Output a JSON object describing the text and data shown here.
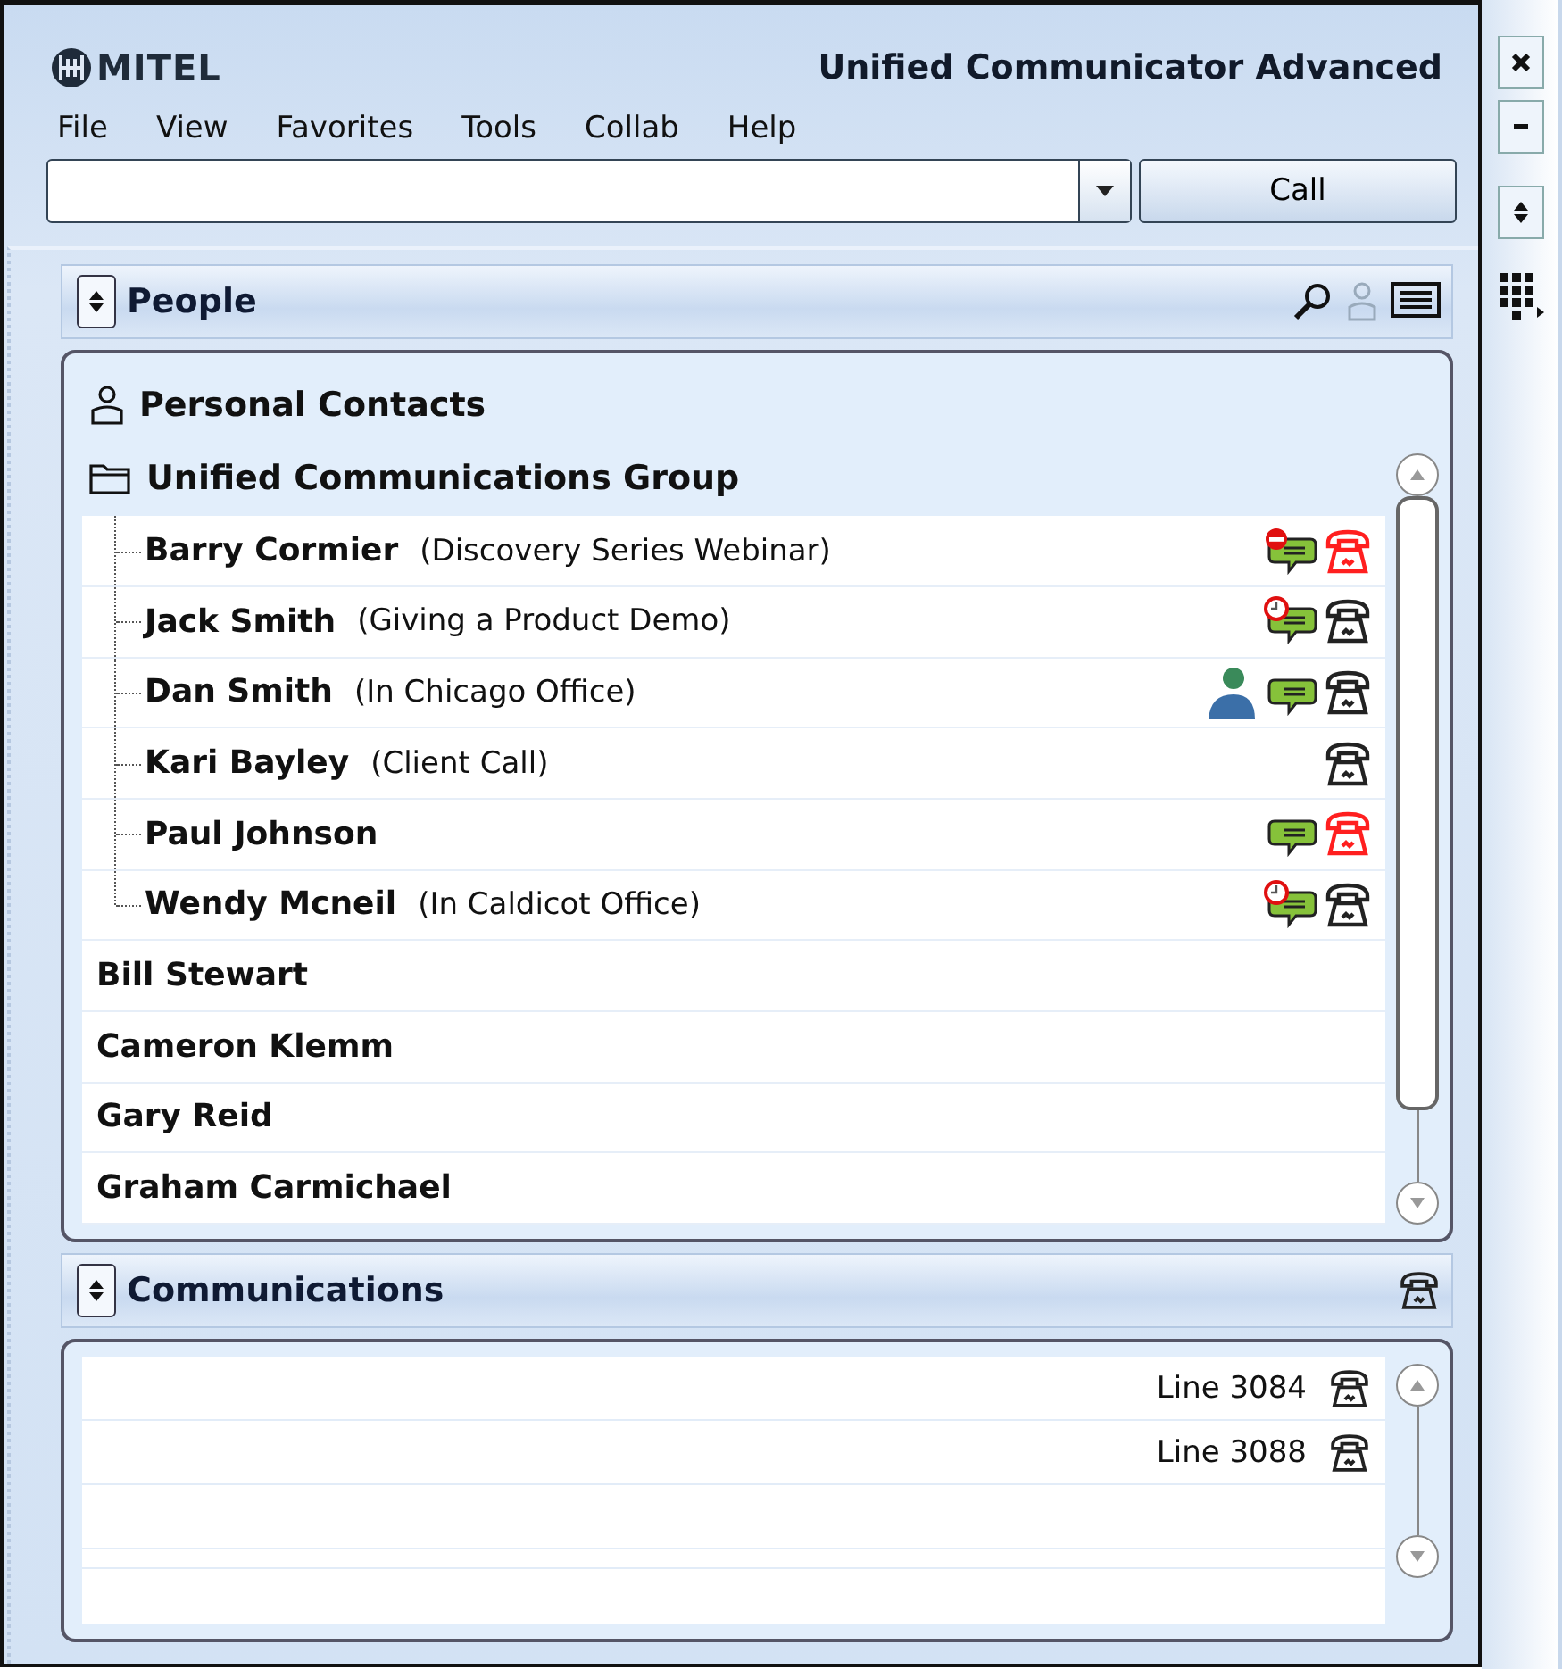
{
  "window": {
    "brand": "MITEL",
    "title": "Unified Communicator Advanced"
  },
  "menu": [
    "File",
    "View",
    "Favorites",
    "Tools",
    "Collab",
    "Help"
  ],
  "dial": {
    "button": "Call"
  },
  "people": {
    "title": "People",
    "personal_contacts": "Personal Contacts",
    "group": {
      "label": "Unified Communications Group",
      "expanded": true,
      "children": [
        {
          "name": "Barry Cormier",
          "status": "(Discovery Series Webinar)",
          "online": false,
          "chat": {
            "kind": "dnd"
          },
          "phone_busy": true
        },
        {
          "name": "Jack Smith",
          "status": "(Giving a Product Demo)",
          "online": false,
          "chat": {
            "kind": "away"
          },
          "phone_busy": false
        },
        {
          "name": "Dan Smith",
          "status": "(In Chicago Office)",
          "online": true,
          "chat": {
            "kind": "available"
          },
          "phone_busy": false
        },
        {
          "name": "Kari Bayley",
          "status": "(Client Call)",
          "online": false,
          "phone_busy": false
        },
        {
          "name": "Paul Johnson",
          "online": false,
          "chat": {
            "kind": "available"
          },
          "phone_busy": true
        },
        {
          "name": "Wendy Mcneil",
          "status": "(In Caldicot Office)",
          "online": false,
          "chat": {
            "kind": "away"
          },
          "phone_busy": false
        }
      ]
    },
    "contacts": [
      "Bill Stewart",
      "Cameron Klemm",
      "Gary Reid",
      "Graham Carmichael"
    ]
  },
  "communications": {
    "title": "Communications",
    "lines": [
      "Line 3084",
      "Line 3088"
    ]
  }
}
